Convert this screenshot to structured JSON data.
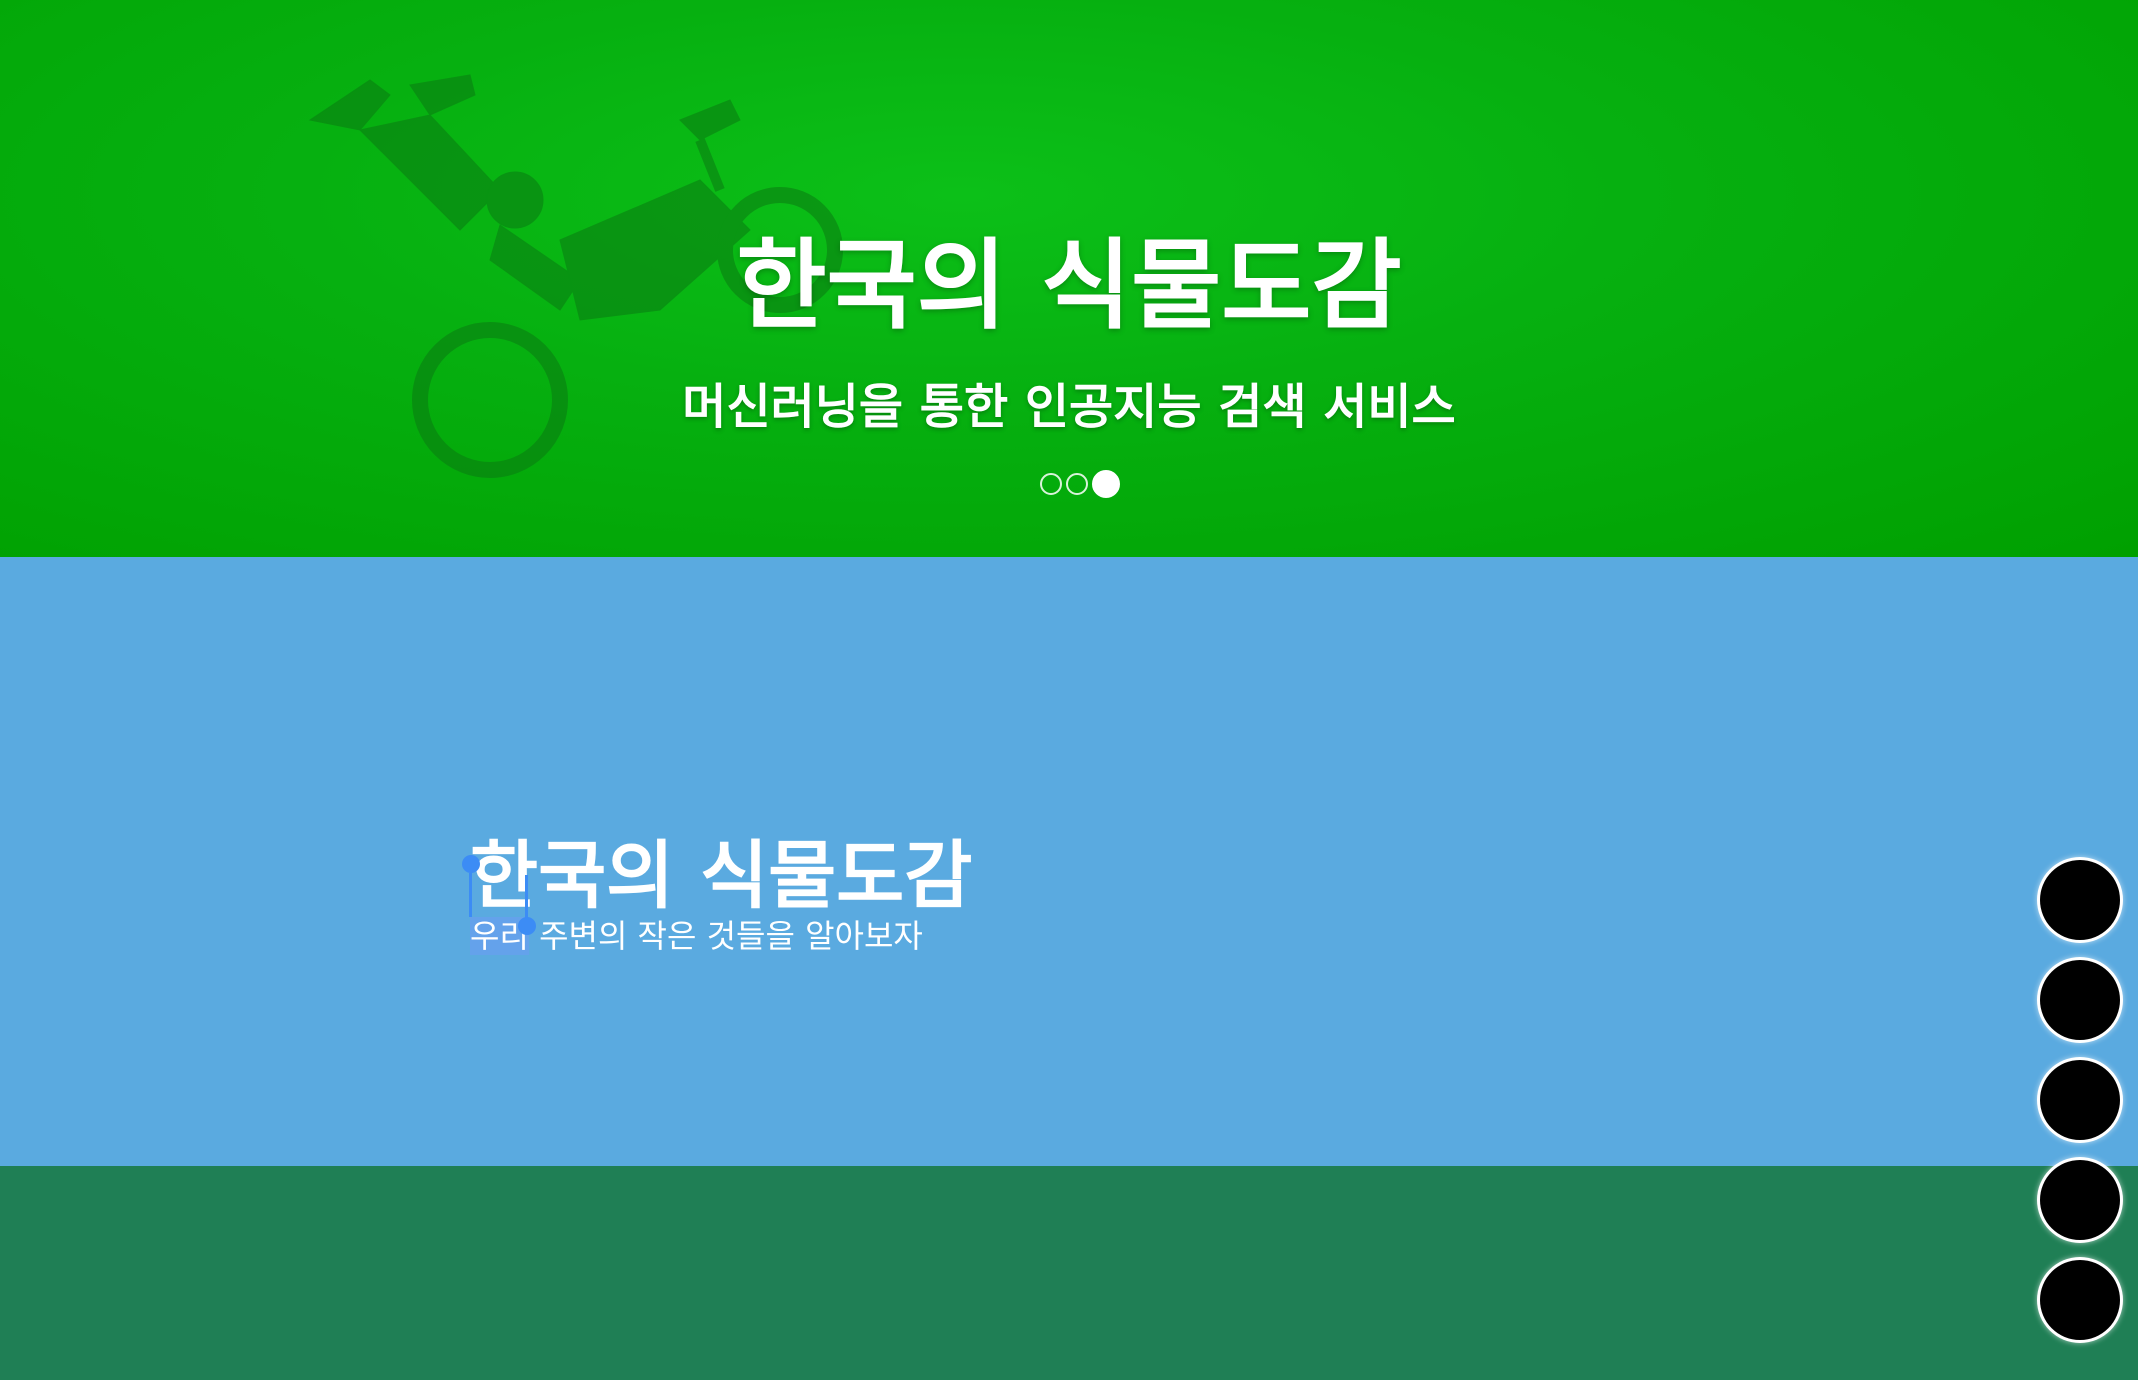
{
  "hero": {
    "title": "한국의 식물도감",
    "subtitle": "머신러닝을 통한 인공지능 검색 서비스",
    "slide_count": 3,
    "active_slide": 3
  },
  "intro": {
    "title": "한국의 식물도감",
    "text_selected": "우리",
    "text_rest": " 주변의 작은 것들을 알아보자"
  },
  "side_nav": {
    "count": 5
  },
  "colors": {
    "hero_green": "#00a800",
    "intro_blue": "#5aaae0",
    "bottom_green": "#1f7f55",
    "selection_handle": "#3c8cf5"
  }
}
